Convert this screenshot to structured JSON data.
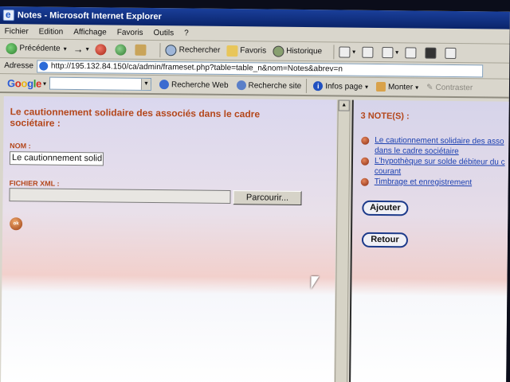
{
  "window": {
    "title": "Notes - Microsoft Internet Explorer"
  },
  "menu": [
    "Fichier",
    "Edition",
    "Affichage",
    "Favoris",
    "Outils",
    "?"
  ],
  "toolbar": {
    "back": "Précédente",
    "search": "Rechercher",
    "favorites": "Favoris",
    "history": "Historique"
  },
  "address": {
    "label": "Adresse",
    "url": "http://195.132.84.150/ca/admin/frameset.php?table=table_n&nom=Notes&abrev=n"
  },
  "google": {
    "logo": "Google",
    "search_web": "Recherche Web",
    "search_site": "Recherche site",
    "page_info": "Infos page",
    "up": "Monter",
    "highlight": "Contraster"
  },
  "left_frame": {
    "heading": "Le cautionnement solidaire des associés dans le cadre sociétaire :",
    "nom_label": "NOM :",
    "nom_value": "Le cautionnement solid",
    "xml_label": "FICHIER XML :",
    "browse_button": "Parcourir...",
    "ok_label": "ok"
  },
  "right_frame": {
    "notes_title": "3 NOTE(S) :",
    "notes": [
      {
        "line1": "Le cautionnement solidaire des asso",
        "line2": "dans le cadre sociétaire"
      },
      {
        "line1": "L'hypothèque sur solde débiteur du c",
        "line2": "courant"
      },
      {
        "line1": "Timbrage et enregistrement",
        "line2": ""
      }
    ],
    "add_button": "Ajouter",
    "back_button": "Retour"
  }
}
